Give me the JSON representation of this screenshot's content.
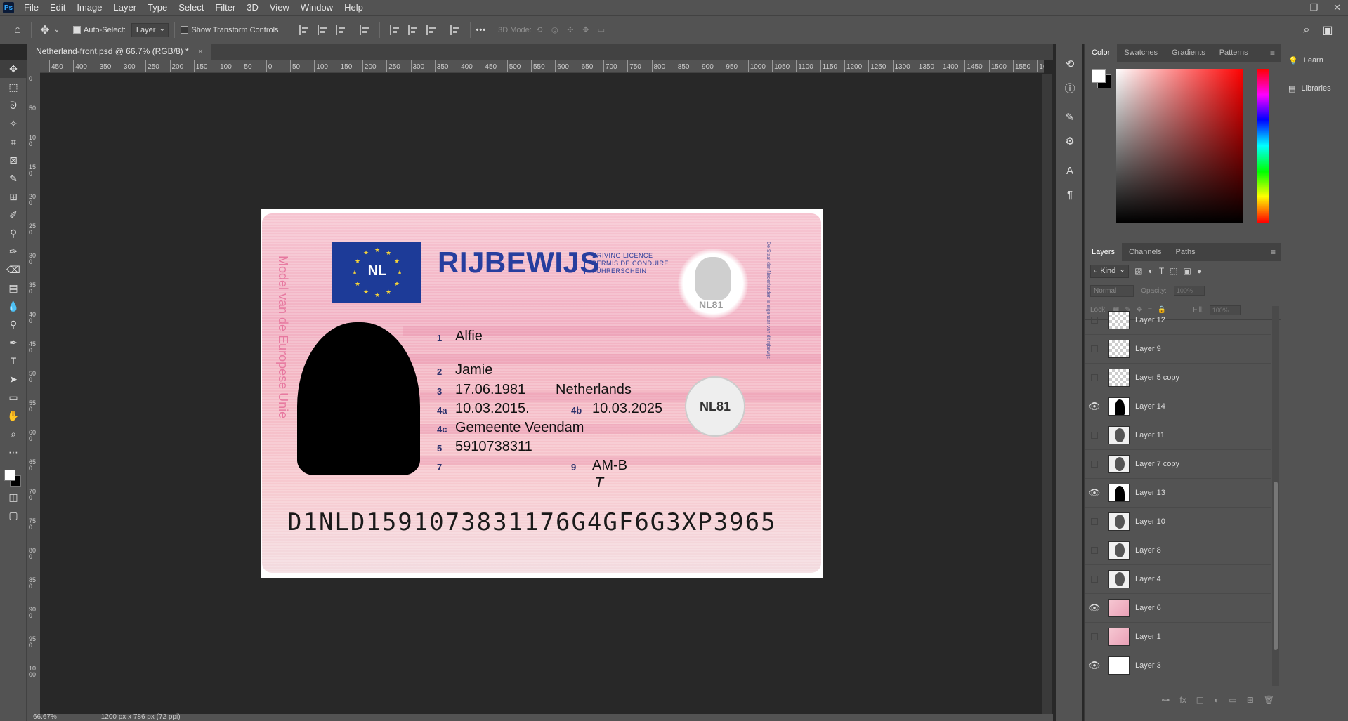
{
  "app": {
    "logo": "Ps",
    "menu": [
      "File",
      "Edit",
      "Image",
      "Layer",
      "Type",
      "Select",
      "Filter",
      "3D",
      "View",
      "Window",
      "Help"
    ],
    "window_controls": [
      "—",
      "❐",
      "✕"
    ]
  },
  "options_bar": {
    "auto_select_label": "Auto-Select:",
    "auto_select_value": "Layer",
    "show_transform_label": "Show Transform Controls",
    "more_label": "•••",
    "mode_3d_label": "3D Mode:"
  },
  "document": {
    "tab_title": "Netherland-front.psd @ 66.7% (RGB/8) *",
    "close": "×"
  },
  "rulers": {
    "horizontal": [
      "450",
      "400",
      "350",
      "300",
      "250",
      "200",
      "150",
      "100",
      "50",
      "0",
      "50",
      "100",
      "150",
      "200",
      "250",
      "300",
      "350",
      "400",
      "450",
      "500",
      "550",
      "600",
      "650",
      "700",
      "750",
      "800",
      "850",
      "900",
      "950",
      "1000",
      "1050",
      "1100",
      "1150",
      "1200",
      "1250",
      "1300",
      "1350",
      "1400",
      "1450",
      "1500",
      "1550",
      "1600",
      "16"
    ],
    "vertical": [
      "0",
      "50",
      "100",
      "150",
      "200",
      "250",
      "300",
      "350",
      "400",
      "450",
      "500",
      "550",
      "600",
      "650",
      "700",
      "750",
      "800",
      "850",
      "900",
      "950",
      "1000"
    ]
  },
  "card": {
    "country_code": "NL",
    "title": "RIJBEWIJS",
    "subtitles": [
      "DRIVING LICENCE",
      "PERMIS DE CONDUIRE",
      "FÜHRERSCHEIN"
    ],
    "side_text": "Model van de Europese Unie",
    "ghost_label": "NL81",
    "seal_label": "NL81",
    "fields": [
      {
        "num": "1",
        "value": "Alfie"
      },
      {
        "num": "2",
        "value": "Jamie"
      },
      {
        "num": "3",
        "value": "17.06.1981"
      },
      {
        "num": "4a",
        "value": "10.03.2015."
      },
      {
        "num": "4c",
        "value": "Gemeente Veendam"
      },
      {
        "num": "5",
        "value": "5910738311"
      },
      {
        "num": "7",
        "value": ""
      }
    ],
    "birthplace": "Netherlands",
    "field_4b": {
      "num": "4b",
      "value": "10.03.2025"
    },
    "field_9": {
      "num": "9",
      "value": "AM-B"
    },
    "signature": "T",
    "mrz": "D1NLD1591073831176G4GF6G3XP3965",
    "microtext": "De Staat der Nederlanden is eigenaar van dit rijbewijs"
  },
  "status_bar": {
    "zoom": "66.67%",
    "doc_size": "1200 px x 786 px (72 ppi)"
  },
  "color_panel": {
    "tabs": [
      "Color",
      "Swatches",
      "Gradients",
      "Patterns"
    ],
    "active_tab": "Color"
  },
  "layers_panel": {
    "tabs": [
      "Layers",
      "Channels",
      "Paths"
    ],
    "kind_label": "Kind",
    "blend_mode": "Normal",
    "opacity_label": "Opacity:",
    "opacity_value": "100%",
    "lock_label": "Lock:",
    "fill_label": "Fill:",
    "fill_value": "100%",
    "layers": [
      {
        "name": "Layer 12",
        "visible": false,
        "thumb": "transparent"
      },
      {
        "name": "Layer 9",
        "visible": false,
        "thumb": "transparent"
      },
      {
        "name": "Layer 5 copy",
        "visible": false,
        "thumb": "transparent"
      },
      {
        "name": "Layer 14",
        "visible": true,
        "thumb": "silhouette"
      },
      {
        "name": "Layer 11",
        "visible": false,
        "thumb": "face"
      },
      {
        "name": "Layer 7 copy",
        "visible": false,
        "thumb": "face"
      },
      {
        "name": "Layer 13",
        "visible": true,
        "thumb": "silhouette"
      },
      {
        "name": "Layer 10",
        "visible": false,
        "thumb": "face"
      },
      {
        "name": "Layer 8",
        "visible": false,
        "thumb": "face"
      },
      {
        "name": "Layer 4",
        "visible": false,
        "thumb": "face"
      },
      {
        "name": "Layer 6",
        "visible": true,
        "thumb": "pink"
      },
      {
        "name": "Layer 1",
        "visible": false,
        "thumb": "pink"
      },
      {
        "name": "Layer 3",
        "visible": true,
        "thumb": "white"
      }
    ]
  },
  "mini_panel": {
    "items": [
      "Learn",
      "Libraries"
    ]
  },
  "colors": {
    "accent": "#31a8ff",
    "card_title": "#273e9e",
    "card_pink": "#f2b1c3"
  }
}
